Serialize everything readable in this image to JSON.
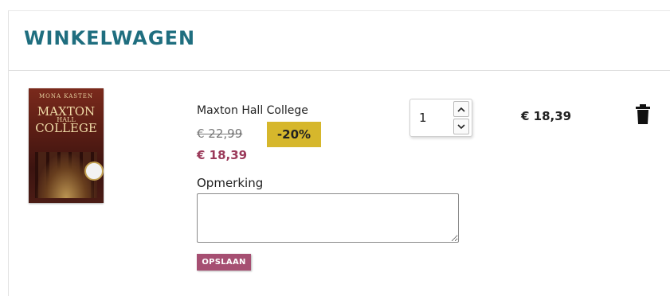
{
  "header": {
    "title": "WINKELWAGEN"
  },
  "item": {
    "cover": {
      "author": "MONA KASTEN",
      "title_line1": "MAXTON",
      "title_line2": "HALL",
      "title_line3": "COLLEGE"
    },
    "name": "Maxton Hall College",
    "old_price": "€ 22,99",
    "discount": "-20%",
    "new_price": "€ 18,39",
    "quantity": "1",
    "total": "€ 18,39",
    "note_label": "Opmerking",
    "note_value": "",
    "save_label": "OPSLAAN"
  },
  "colors": {
    "title": "#1f6e7f",
    "price_new": "#9b3a5a",
    "discount_bg": "#d6b72c",
    "save_bg": "#a64f72"
  },
  "icons": [
    "chevron-up-icon",
    "chevron-down-icon",
    "trash-icon"
  ]
}
